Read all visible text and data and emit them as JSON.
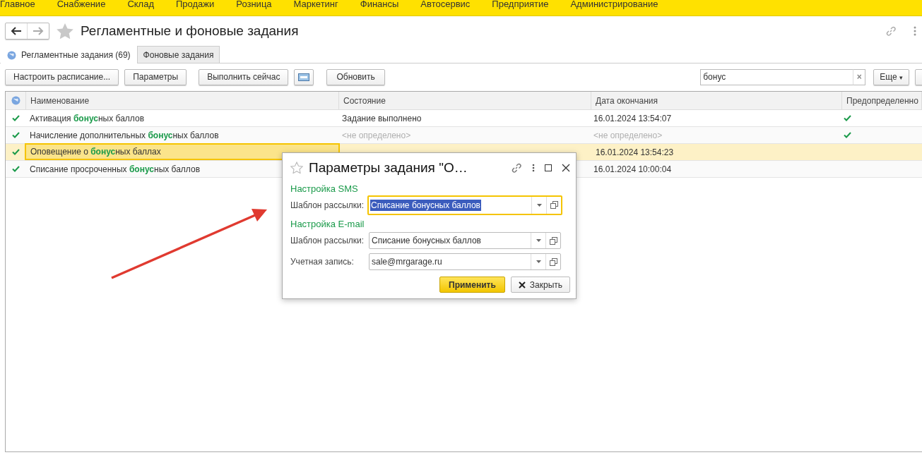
{
  "menu": [
    "Главное",
    "Снабжение",
    "Склад",
    "Продажи",
    "Розница",
    "Маркетинг",
    "Финансы",
    "Автосервис",
    "Предприятие",
    "Администрирование"
  ],
  "title": "Регламентные и фоновые задания",
  "tabs": [
    {
      "label": "Регламентные задания (69)",
      "selected": true
    },
    {
      "label": "Фоновые задания",
      "selected": false
    }
  ],
  "toolbar": {
    "buttons": [
      "Настроить расписание...",
      "Параметры",
      "Выполнить сейчас"
    ],
    "refresh": "Обновить",
    "search": {
      "value": "бонус",
      "clear": "×"
    },
    "more": "Еще",
    "more_caret": "▾"
  },
  "table": {
    "columns": [
      "Наименование",
      "Состояние",
      "Дата окончания",
      "Предопределенно"
    ],
    "rows": [
      {
        "name": "Активация **бонус**ных баллов",
        "status": "Задание выполнено",
        "status_empty": false,
        "date": "16.01.2024 13:54:07",
        "date_empty": false,
        "predefined": true,
        "selected": false
      },
      {
        "name": "Начисление дополнительных **бонус**ных баллов",
        "status": "<не определено>",
        "status_empty": true,
        "date": "<не определено>",
        "date_empty": true,
        "predefined": true,
        "selected": false
      },
      {
        "name": "Оповещение о **бонус**ных баллах",
        "date": "16.01.2024 13:54:23",
        "date_empty": false,
        "predefined": false,
        "selected": true
      },
      {
        "name": "Списание просроченных **бонус**ных баллов",
        "date": "16.01.2024 10:00:04",
        "date_empty": false,
        "predefined": false,
        "selected": false
      }
    ]
  },
  "dialog": {
    "title": "Параметры задания \"О…",
    "sections": [
      {
        "heading": "Настройка SMS",
        "fields": [
          {
            "label": "Шаблон рассылки:",
            "value": "Списание бонусных баллов",
            "focused": true
          }
        ]
      },
      {
        "heading": "Настройка E-mail",
        "fields": [
          {
            "label": "Шаблон рассылки:",
            "value": "Списание бонусных баллов",
            "focused": false
          },
          {
            "label": "Учетная запись:",
            "value": "sale@mrgarage.ru",
            "focused": false
          }
        ]
      }
    ],
    "apply": "Применить",
    "close": "Закрыть"
  }
}
